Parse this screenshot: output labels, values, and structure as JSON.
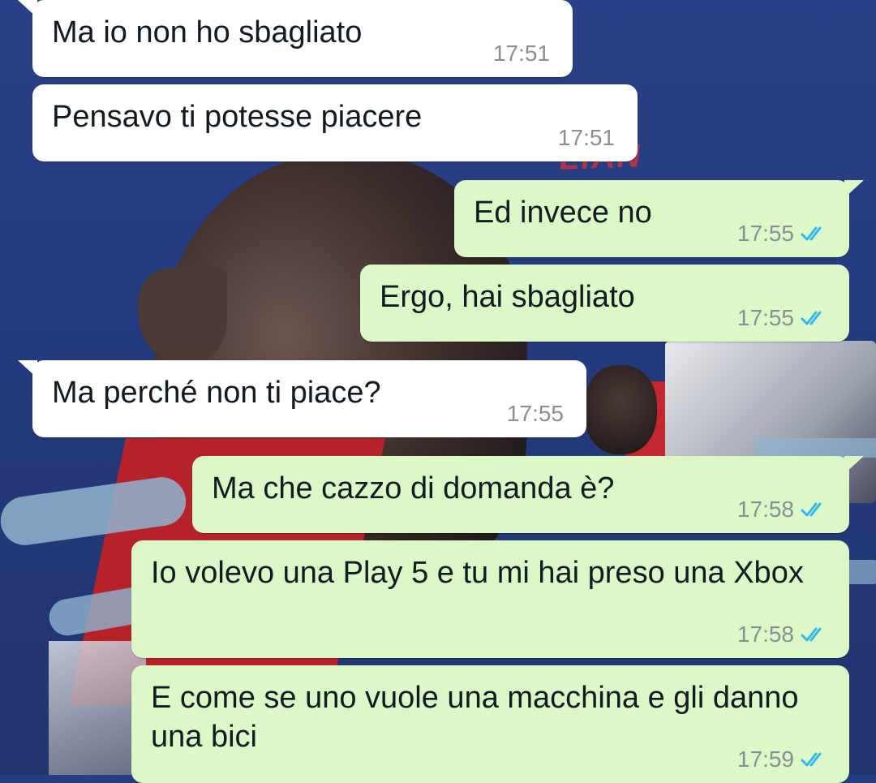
{
  "theme": {
    "incoming_bubble": "#ffffff",
    "outgoing_bubble": "#dcf8c6",
    "read_tick_color": "#34b7f1",
    "timestamp_color": "#8a8f93"
  },
  "wallpaper": {
    "overlay_text": "LIAN"
  },
  "messages": [
    {
      "direction": "incoming",
      "text": "Ma io non ho sbagliato",
      "time": "17:51"
    },
    {
      "direction": "incoming",
      "text": "Pensavo ti potesse piacere",
      "time": "17:51"
    },
    {
      "direction": "outgoing",
      "text": "Ed invece no",
      "time": "17:55",
      "status": "read"
    },
    {
      "direction": "outgoing",
      "text": "Ergo, hai sbagliato",
      "time": "17:55",
      "status": "read"
    },
    {
      "direction": "incoming",
      "text": "Ma perché non ti piace?",
      "time": "17:55"
    },
    {
      "direction": "outgoing",
      "text": "Ma che cazzo di domanda è?",
      "time": "17:58",
      "status": "read"
    },
    {
      "direction": "outgoing",
      "text": "Io volevo una Play 5 e tu mi hai preso una Xbox",
      "time": "17:58",
      "status": "read"
    },
    {
      "direction": "outgoing",
      "text": "E come se uno vuole una macchina e gli danno una bici",
      "time": "17:59",
      "status": "read"
    }
  ]
}
